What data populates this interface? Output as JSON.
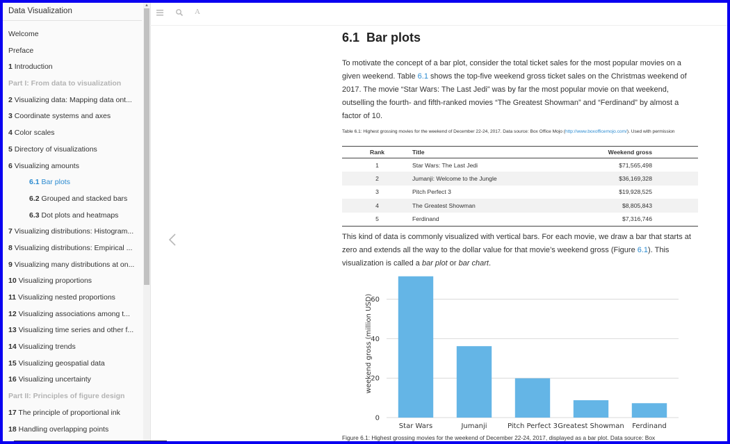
{
  "sidebar": {
    "title": "Data Visualization",
    "items": [
      {
        "num": "",
        "label": "Welcome",
        "kind": "normal"
      },
      {
        "num": "",
        "label": "Preface",
        "kind": "normal"
      },
      {
        "num": "1",
        "label": "Introduction",
        "kind": "normal"
      },
      {
        "num": "",
        "label": "Part I: From data to visualization",
        "kind": "part"
      },
      {
        "num": "2",
        "label": "Visualizing data: Mapping data ont...",
        "kind": "normal"
      },
      {
        "num": "3",
        "label": "Coordinate systems and axes",
        "kind": "normal"
      },
      {
        "num": "4",
        "label": "Color scales",
        "kind": "normal"
      },
      {
        "num": "5",
        "label": "Directory of visualizations",
        "kind": "normal"
      },
      {
        "num": "6",
        "label": "Visualizing amounts",
        "kind": "normal"
      },
      {
        "num": "6.1",
        "label": "Bar plots",
        "kind": "active"
      },
      {
        "num": "6.2",
        "label": "Grouped and stacked bars",
        "kind": "sub"
      },
      {
        "num": "6.3",
        "label": "Dot plots and heatmaps",
        "kind": "sub"
      },
      {
        "num": "7",
        "label": "Visualizing distributions: Histogram...",
        "kind": "normal"
      },
      {
        "num": "8",
        "label": "Visualizing distributions: Empirical ...",
        "kind": "normal"
      },
      {
        "num": "9",
        "label": "Visualizing many distributions at on...",
        "kind": "normal"
      },
      {
        "num": "10",
        "label": "Visualizing proportions",
        "kind": "normal"
      },
      {
        "num": "11",
        "label": "Visualizing nested proportions",
        "kind": "normal"
      },
      {
        "num": "12",
        "label": "Visualizing associations among t...",
        "kind": "normal"
      },
      {
        "num": "13",
        "label": "Visualizing time series and other f...",
        "kind": "normal"
      },
      {
        "num": "14",
        "label": "Visualizing trends",
        "kind": "normal"
      },
      {
        "num": "15",
        "label": "Visualizing geospatial data",
        "kind": "normal"
      },
      {
        "num": "16",
        "label": "Visualizing uncertainty",
        "kind": "normal"
      },
      {
        "num": "",
        "label": "Part II: Principles of figure design",
        "kind": "part"
      },
      {
        "num": "17",
        "label": "The principle of proportional ink",
        "kind": "normal"
      },
      {
        "num": "18",
        "label": "Handling overlapping points",
        "kind": "normal"
      }
    ]
  },
  "toolbar": {
    "icons": [
      "menu-icon",
      "search-icon",
      "font-icon"
    ],
    "font_glyph": "A"
  },
  "main": {
    "section_number": "6.1",
    "section_title": "Bar plots",
    "intro": {
      "p1": "To motivate the concept of a bar plot, consider the total ticket sales for the most popular movies on a given weekend. Table ",
      "ref": "6.1",
      "p2": " shows the top-five weekend gross ticket sales on the Christmas weekend of 2017. The movie “Star Wars: The Last Jedi” was by far the most popular movie on that weekend, outselling the fourth- and fifth-ranked movies “The Greatest Showman” and “Ferdinand” by almost a factor of 10."
    },
    "table_caption": {
      "p1": "Table 6.1: Highest grossing movies for the weekend of December 22-24, 2017. Data source: Box Office Mojo (",
      "link": "http://www.boxofficemojo.com/",
      "p2": "). Used with permission"
    },
    "table": {
      "headers": [
        "Rank",
        "Title",
        "Weekend gross"
      ],
      "rows": [
        [
          "1",
          "Star Wars: The Last Jedi",
          "$71,565,498"
        ],
        [
          "2",
          "Jumanji: Welcome to the Jungle",
          "$36,169,328"
        ],
        [
          "3",
          "Pitch Perfect 3",
          "$19,928,525"
        ],
        [
          "4",
          "The Greatest Showman",
          "$8,805,843"
        ],
        [
          "5",
          "Ferdinand",
          "$7,316,746"
        ]
      ]
    },
    "body2": {
      "p1": "This kind of data is commonly visualized with vertical bars. For each movie, we draw a bar that starts at zero and extends all the way to the dollar value for that movie’s weekend gross (Figure ",
      "ref": "6.1",
      "p2": "). This visualization is called a ",
      "em1": "bar plot",
      "p3": " or ",
      "em2": "bar chart",
      "p4": "."
    },
    "figure_caption": "Figure 6.1: Highest grossing movies for the weekend of December 22-24, 2017, displayed as a bar plot. Data source: Box"
  },
  "chart_data": {
    "type": "bar",
    "categories": [
      "Star Wars",
      "Jumanji",
      "Pitch Perfect 3",
      "Greatest Showman",
      "Ferdinand"
    ],
    "values": [
      71.6,
      36.2,
      19.9,
      8.8,
      7.3
    ],
    "ylabel": "weekend gross (million USD)",
    "xlabel": "",
    "yticks": [
      0,
      20,
      40,
      60
    ],
    "ylim": [
      0,
      75
    ],
    "grid": "horizontal",
    "bar_color": "#64b5e6"
  },
  "colors": {
    "link": "#2a8ad0",
    "background": "#0a00f0",
    "bar": "#64b5e6"
  }
}
